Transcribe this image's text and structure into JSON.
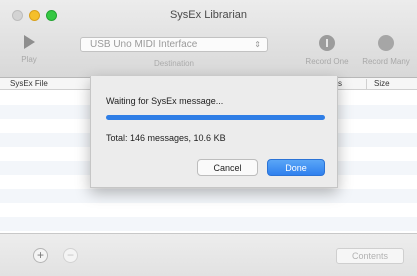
{
  "window": {
    "title": "SysEx Librarian"
  },
  "toolbar": {
    "play_label": "Play",
    "destination_value": "USB Uno MIDI Interface",
    "destination_label": "Destination",
    "record_one_label": "Record One",
    "record_many_label": "Record Many"
  },
  "table": {
    "columns": [
      "SysEx File",
      "s",
      "Size"
    ],
    "rows": []
  },
  "dialog": {
    "message": "Waiting for SysEx message...",
    "progress": 1.0,
    "total": "Total: 146 messages, 10.6 KB",
    "cancel_label": "Cancel",
    "done_label": "Done"
  },
  "bottom": {
    "add_symbol": "+",
    "remove_symbol": "−",
    "contents_label": "Contents"
  },
  "colors": {
    "accent": "#2f7ee6",
    "close_light": "#d3d3d3",
    "minimize_light": "#f5bf2a",
    "zoom_light": "#35c843"
  },
  "icons": {
    "play": "play-icon",
    "record_one": "record-one-icon",
    "record_many": "record-many-icon",
    "popup_arrows": "chevron-up-down-icon"
  }
}
